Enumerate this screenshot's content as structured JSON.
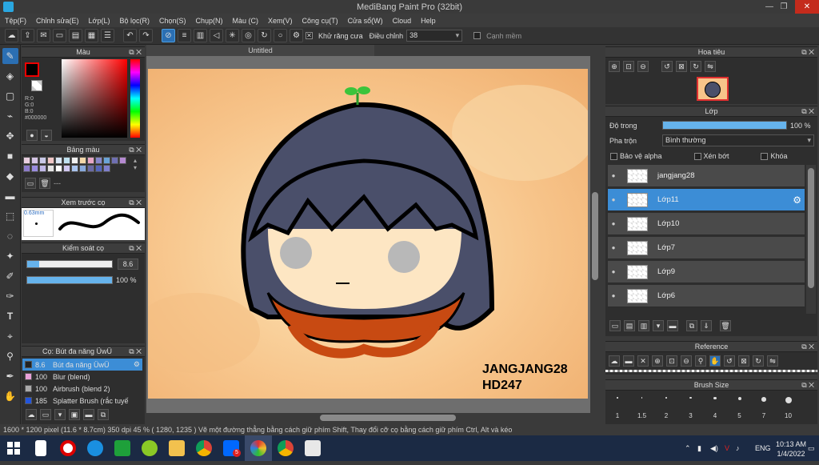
{
  "window": {
    "title": "MediBang Paint Pro (32bit)",
    "minimize": "—",
    "maximize": "❐",
    "close": "✕"
  },
  "menu": [
    "Tệp(F)",
    "Chỉnh sửa(E)",
    "Lớp(L)",
    "Bộ lọc(R)",
    "Chọn(S)",
    "Chụp(N)",
    "Màu (C)",
    "Xem(V)",
    "Công cụ(T)",
    "Cửa sổ(W)",
    "Cloud",
    "Help"
  ],
  "toolbar": {
    "antialias_label": "Khử răng cưa",
    "adjust_label": "Điều chỉnh",
    "adjust_value": "38",
    "snap_label": "Cạnh mềm"
  },
  "color_panel": {
    "title": "Màu",
    "r": "R:0",
    "g": "G:0",
    "b": "B:0",
    "hex": "#000000",
    "primary_color": "#000000"
  },
  "palette_panel": {
    "title": "Bảng màu",
    "swatches": [
      "#e9cfe0",
      "#d6c5e6",
      "#c9c9e8",
      "#f0c7c7",
      "#d9e6f5",
      "#bfe1f0",
      "#f1f1f1",
      "#f3d8a8",
      "#e6a6c6",
      "#8888cc",
      "#6aa3d6",
      "#6f6fb2",
      "#b58ad1",
      "#8c7bc9",
      "#9a8ce0",
      "#c0b8e8",
      "#e4e4e4",
      "#ffffff",
      "#d0c8f0",
      "#a9c4ee",
      "#88aadd",
      "#6a6aa5",
      "#5566bb",
      "#7f7fcc"
    ],
    "dash": "---"
  },
  "brush_preview": {
    "title": "Xem trước cọ",
    "size": "0.63mm"
  },
  "brush_control": {
    "title": "Kiểm soát cọ",
    "size_value": "8.6",
    "size_fraction": 0.94,
    "opacity_value": "100 %",
    "opacity_fraction": 1.0
  },
  "brush_list": {
    "title": "Cọ: Bút đa năng ÜwÜ",
    "items": [
      {
        "size": "8.6",
        "name": "Bút đa năng ÜwÜ",
        "color": "#222222",
        "selected": true
      },
      {
        "size": "100",
        "name": "Blur (blend)",
        "color": "#e8a0d8",
        "selected": false
      },
      {
        "size": "100",
        "name": "Airbrush (blend 2)",
        "color": "#aaaaaa",
        "selected": false
      },
      {
        "size": "185",
        "name": "Splatter Brush (rắc tuyế",
        "color": "#2255dd",
        "selected": false
      }
    ]
  },
  "document": {
    "tab": "Untitled"
  },
  "artwork": {
    "signature_line1": "JANGJANG28",
    "signature_line2": "HD247"
  },
  "navigator": {
    "title": "Hoa tiêu"
  },
  "layer_panel": {
    "title": "Lớp",
    "opacity_label": "Độ trong",
    "opacity_value": "100 %",
    "opacity_fraction": 1.0,
    "blend_label": "Pha trộn",
    "blend_value": "Bình thường",
    "protect_alpha": "Bảo vệ alpha",
    "clipping": "Xén bớt",
    "lock": "Khóa",
    "layers": [
      {
        "name": "jangjang28",
        "selected": false
      },
      {
        "name": "Lớp11",
        "selected": true
      },
      {
        "name": "Lớp10",
        "selected": false
      },
      {
        "name": "Lớp7",
        "selected": false
      },
      {
        "name": "Lớp9",
        "selected": false
      },
      {
        "name": "Lớp6",
        "selected": false
      }
    ]
  },
  "reference_panel": {
    "title": "Reference"
  },
  "brush_size_panel": {
    "title": "Brush Size",
    "sizes": [
      "1",
      "1.5",
      "2",
      "3",
      "4",
      "5",
      "7",
      "10"
    ]
  },
  "status": {
    "text": "1600 * 1200 pixel  (11.6 * 8.7cm)  350 dpi  45 %  ( 1280, 1235 )  Vẽ một đường thẳng bằng cách giữ phím Shift, Thay đổi cỡ cọ bằng cách giữ phím Ctrl, Alt và kéo"
  },
  "taskbar": {
    "time": "10:13 AM",
    "date": "1/4/2022",
    "lang": "ENG",
    "zalo_badge": "5"
  }
}
